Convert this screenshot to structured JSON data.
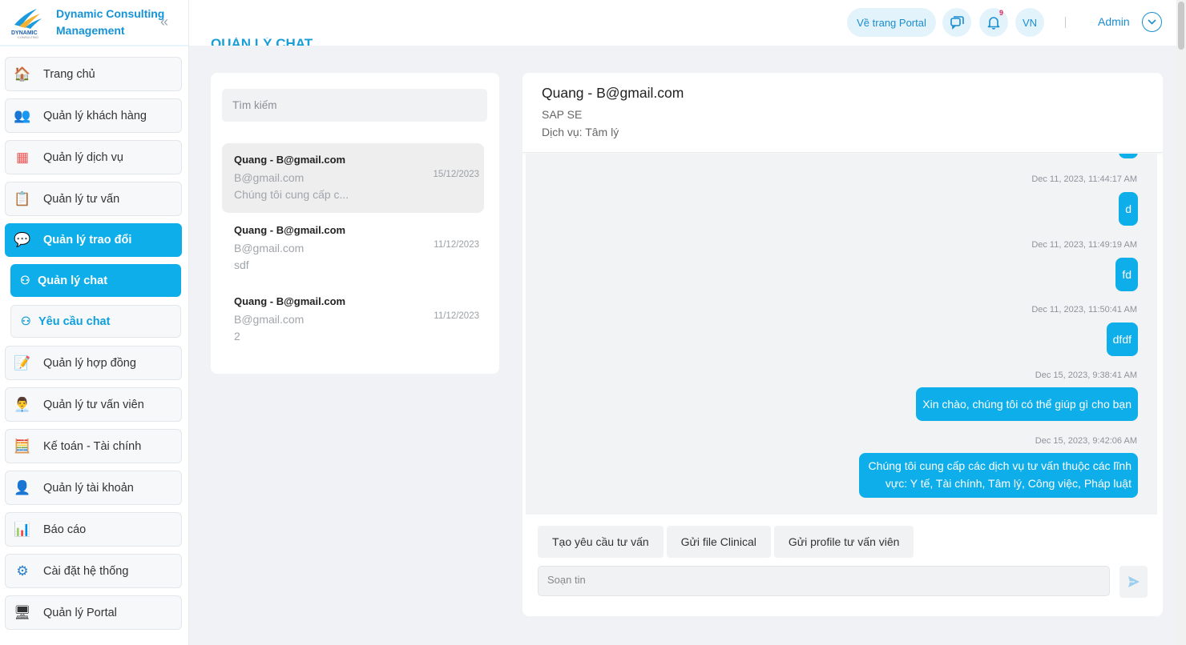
{
  "brand": {
    "line1": "Dynamic Consulting",
    "line2": "Management",
    "logo_text": "DYNAMIC",
    "logo_sub": "CONSULTING"
  },
  "sidebar": {
    "collapse_glyph": "«",
    "items": [
      {
        "label": "Trang chủ",
        "icon": "🏠"
      },
      {
        "label": "Quản lý khách hàng",
        "icon": "👥"
      },
      {
        "label": "Quản lý dịch vụ",
        "icon": "▦"
      },
      {
        "label": "Quản lý tư vấn",
        "icon": "📋"
      },
      {
        "label": "Quản lý trao đổi",
        "icon": "💬"
      },
      {
        "label": "Quản lý chat",
        "icon": "⚇"
      },
      {
        "label": "Yêu cầu chat",
        "icon": "⚇"
      },
      {
        "label": "Quản lý hợp đồng",
        "icon": "📝"
      },
      {
        "label": "Quản lý tư vấn viên",
        "icon": "👨‍💼"
      },
      {
        "label": "Kế toán - Tài chính",
        "icon": "🧮"
      },
      {
        "label": "Quản lý tài khoản",
        "icon": "👤"
      },
      {
        "label": "Báo cáo",
        "icon": "📊"
      },
      {
        "label": "Cài đặt hệ thống",
        "icon": "⚙"
      },
      {
        "label": "Quản lý Portal",
        "icon": "🖥"
      }
    ]
  },
  "header": {
    "portal_label": "Về trang Portal",
    "notification_count": "9",
    "lang": "VN",
    "user": "Admin"
  },
  "page": {
    "title": "QUẢN LÝ CHAT"
  },
  "search": {
    "placeholder": "Tìm kiếm"
  },
  "conversations": [
    {
      "name": "Quang - B@gmail.com",
      "email": "B@gmail.com",
      "last_message": "Chúng tôi cung cấp c...",
      "date": "15/12/2023"
    },
    {
      "name": "Quang - B@gmail.com",
      "email": "B@gmail.com",
      "last_message": "sdf",
      "date": "11/12/2023"
    },
    {
      "name": "Quang - B@gmail.com",
      "email": "B@gmail.com",
      "last_message": "2",
      "date": "11/12/2023"
    }
  ],
  "chat": {
    "name": "Quang - B@gmail.com",
    "company": "SAP SE",
    "service": "Dịch vụ: Tâm lý",
    "messages": [
      {
        "time": "Dec 11, 2023, 11:44:17 AM",
        "text": "d"
      },
      {
        "time": "Dec 11, 2023, 11:49:19 AM",
        "text": "fd"
      },
      {
        "time": "Dec 11, 2023, 11:50:41 AM",
        "text": "dfdf"
      },
      {
        "time": "Dec 15, 2023, 9:38:41 AM",
        "text": "Xin chào, chúng tôi có thể giúp gì cho bạn"
      },
      {
        "time": "Dec 15, 2023, 9:42:06 AM",
        "text_line1": "Chúng tôi cung cấp các dịch vụ tư vấn thuộc các lĩnh",
        "text_line2": "vực: Y tế, Tài chính, Tâm lý, Công việc, Pháp luật"
      }
    ],
    "actions": [
      "Tạo yêu cầu tư vấn",
      "Gửi file Clinical",
      "Gửi profile tư vấn viên"
    ],
    "compose_placeholder": "Soạn tin"
  },
  "colors": {
    "accent": "#0eaeea",
    "brand": "#1493d8",
    "pill_bg": "#e3f3fb"
  }
}
